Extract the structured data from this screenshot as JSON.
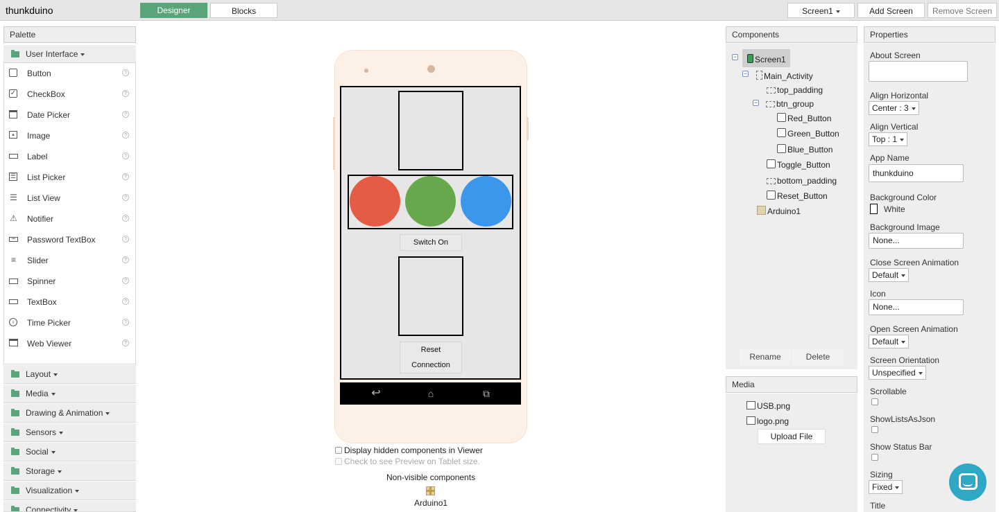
{
  "app": {
    "name": "thunkduino",
    "tabs": {
      "designer": "Designer",
      "blocks": "Blocks"
    },
    "screen_selector": "Screen1",
    "add_screen": "Add Screen",
    "remove_screen": "Remove Screen"
  },
  "palette": {
    "title": "Palette",
    "open_category": "User Interface",
    "items": [
      {
        "label": "Button",
        "icon": "button-icon",
        "help": "?"
      },
      {
        "label": "CheckBox",
        "icon": "checkbox-icon",
        "help": "?"
      },
      {
        "label": "Date Picker",
        "icon": "calendar-icon",
        "help": "?"
      },
      {
        "label": "Image",
        "icon": "image-icon",
        "help": "?"
      },
      {
        "label": "Label",
        "icon": "label-icon",
        "help": "?"
      },
      {
        "label": "List Picker",
        "icon": "list-picker-icon",
        "help": "?"
      },
      {
        "label": "List View",
        "icon": "list-view-icon",
        "help": "?"
      },
      {
        "label": "Notifier",
        "icon": "warning-icon",
        "help": "?"
      },
      {
        "label": "Password TextBox",
        "icon": "password-icon",
        "help": "?"
      },
      {
        "label": "Slider",
        "icon": "slider-icon",
        "help": "?"
      },
      {
        "label": "Spinner",
        "icon": "spinner-icon",
        "help": "?"
      },
      {
        "label": "TextBox",
        "icon": "textbox-icon",
        "help": "?"
      },
      {
        "label": "Time Picker",
        "icon": "clock-icon",
        "help": "?"
      },
      {
        "label": "Web Viewer",
        "icon": "web-viewer-icon",
        "help": "?"
      }
    ],
    "categories": [
      "Layout",
      "Media",
      "Drawing & Animation",
      "Sensors",
      "Social",
      "Storage",
      "Visualization",
      "Connectivity"
    ]
  },
  "viewer": {
    "switch_button": "Switch On",
    "reset_button_line1": "Reset",
    "reset_button_line2": "Connection",
    "display_hidden": "Display hidden components in Viewer",
    "tablet_preview": "Check to see Preview on Tablet size.",
    "nonvisible_title": "Non-visible components",
    "nonvisible_item": "Arduino1",
    "colors": {
      "red": "#e45c45",
      "green": "#67a84d",
      "blue": "#3b97ec"
    }
  },
  "components": {
    "title": "Components",
    "tree": [
      {
        "label": "Screen1",
        "icon": "phone-icon",
        "toggle": "⊟"
      },
      {
        "label": "Main_Activity",
        "icon": "vertical-arrangement-icon",
        "toggle": "⊟"
      },
      {
        "label": "top_padding",
        "icon": "horizontal-arrangement-icon"
      },
      {
        "label": "btn_group",
        "icon": "horizontal-arrangement-icon",
        "toggle": "⊟"
      },
      {
        "label": "Red_Button",
        "icon": "button-icon"
      },
      {
        "label": "Green_Button",
        "icon": "button-icon"
      },
      {
        "label": "Blue_Button",
        "icon": "button-icon"
      },
      {
        "label": "Toggle_Button",
        "icon": "button-icon"
      },
      {
        "label": "bottom_padding",
        "icon": "horizontal-arrangement-icon"
      },
      {
        "label": "Reset_Button",
        "icon": "button-icon"
      },
      {
        "label": "Arduino1",
        "icon": "extension-icon"
      }
    ],
    "rename": "Rename",
    "delete": "Delete"
  },
  "media": {
    "title": "Media",
    "files": [
      "USB.png",
      "logo.png"
    ],
    "upload": "Upload File"
  },
  "properties": {
    "title": "Properties",
    "about_screen": "About Screen",
    "align_horizontal": "Align Horizontal",
    "align_horizontal_value": "Center : 3",
    "align_vertical": "Align Vertical",
    "align_vertical_value": "Top : 1",
    "app_name": "App Name",
    "app_name_value": "thunkduino",
    "background_color": "Background Color",
    "background_color_value": "White",
    "background_image": "Background Image",
    "background_image_value": "None...",
    "close_screen_animation": "Close Screen Animation",
    "close_screen_animation_value": "Default",
    "icon": "Icon",
    "icon_value": "None...",
    "open_screen_animation": "Open Screen Animation",
    "open_screen_animation_value": "Default",
    "screen_orientation": "Screen Orientation",
    "screen_orientation_value": "Unspecified",
    "scrollable": "Scrollable",
    "show_lists_as_json": "ShowListsAsJson",
    "show_status_bar": "Show Status Bar",
    "sizing": "Sizing",
    "sizing_value": "Fixed",
    "title_prop": "Title"
  },
  "accent_color": "#5ba479"
}
